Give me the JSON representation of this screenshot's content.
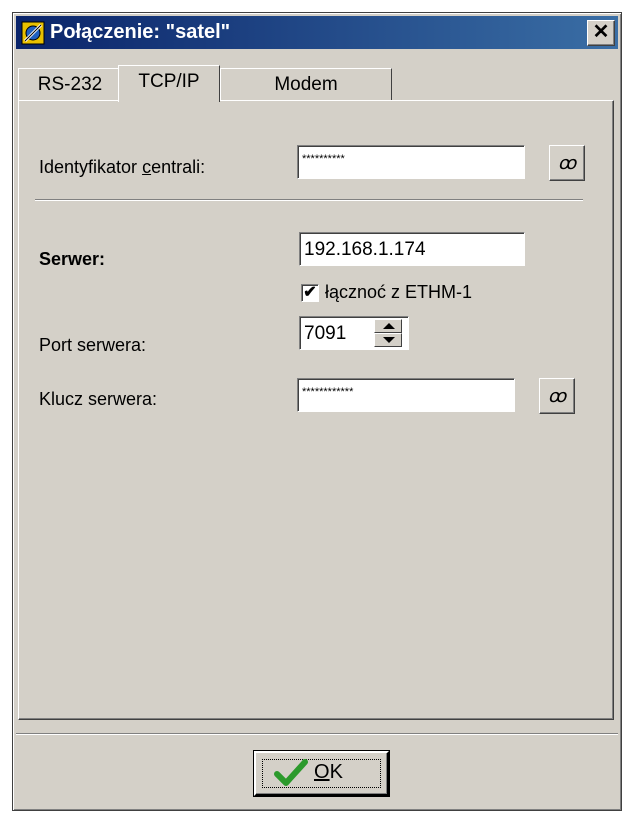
{
  "window": {
    "title": "Połączenie: \"satel\""
  },
  "tabs": [
    {
      "label": "RS-232"
    },
    {
      "label": "TCP/IP"
    },
    {
      "label": "Modem"
    }
  ],
  "form": {
    "id_label_pre": "Identyfikator ",
    "id_label_accel": "c",
    "id_label_post": "entrali:",
    "id_value": "**********",
    "server_label": "Serwer:",
    "server_value": "192.168.1.174",
    "ethm_checkbox_label": "łącznoć z ETHM-1",
    "ethm_checked": true,
    "port_label": "Port serwera:",
    "port_value": "7091",
    "key_label": "Klucz serwera:",
    "key_value": "************"
  },
  "ok_button": {
    "accel": "O",
    "rest": "K"
  },
  "icons": {
    "app": "satel-app-icon",
    "close": "close-icon",
    "show_password": "glasses-icon",
    "ok_check": "checkmark-icon"
  },
  "colors": {
    "titlebar_start": "#0a246a",
    "titlebar_end": "#3a6ea5",
    "face": "#d4d0c8",
    "ok_check": "#2c9a2c"
  }
}
